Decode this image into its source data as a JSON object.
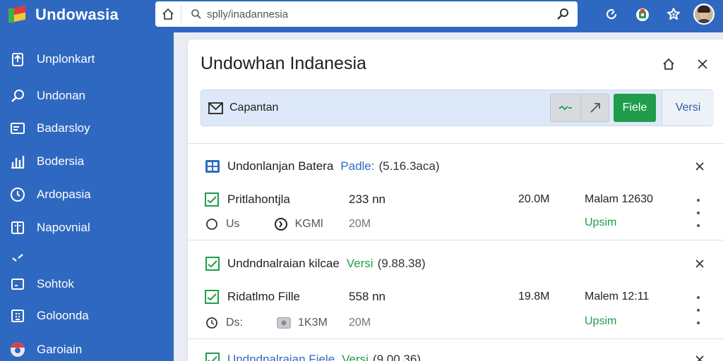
{
  "app": {
    "name": "Undowasia"
  },
  "search": {
    "value": "splly/inadannesia"
  },
  "sidebar": {
    "items": [
      {
        "label": "Unplonkart",
        "icon": "upload-icon"
      },
      {
        "label": "Undonan",
        "icon": "search-icon"
      },
      {
        "label": "Badarsloy",
        "icon": "mail-icon"
      },
      {
        "label": "Bodersia",
        "icon": "chart-icon"
      },
      {
        "label": "Ardopasia",
        "icon": "clock-icon"
      },
      {
        "label": "Napovnial",
        "icon": "document-icon"
      },
      {
        "label": "",
        "icon": "check-icon"
      },
      {
        "label": "Sohtok",
        "icon": "square-icon"
      },
      {
        "label": "Goloonda",
        "icon": "grid-icon"
      },
      {
        "label": "Garoiain",
        "icon": "globe-icon"
      }
    ]
  },
  "panel": {
    "title": "Undowhan Indanesia",
    "toolbar": {
      "label": "Capantan",
      "file_label": "Fiele",
      "version_label": "Versi"
    },
    "groups": [
      {
        "title": "Undonlanjan Batera",
        "tag": "Padle:",
        "version": "(5.16.3aca)",
        "row": {
          "name": "Pritlahontjla",
          "size": "233 nn",
          "mb": "20.0M",
          "date": "Malam 12630",
          "sub1": "Us",
          "sub2": "KGMl",
          "submb": "20M",
          "status": "Upsim"
        }
      },
      {
        "title": "Undndnalraian kilcae",
        "tag": "Versi",
        "version": "(9.88.38)",
        "row": {
          "name": "Ridatlmo Fille",
          "size": "558 nn",
          "mb": "19.8M",
          "date": "Malem 12:11",
          "sub1": "Ds:",
          "sub2": "1K3M",
          "submb": "20M",
          "status": "Upsim"
        }
      },
      {
        "title": "Undndnalraian Fiele",
        "tag": "Versi",
        "version": "(9.00.36)"
      }
    ]
  },
  "colors": {
    "brand": "#2f68c0",
    "accent_green": "#1f9d4b",
    "link_blue": "#2e6bc2"
  }
}
